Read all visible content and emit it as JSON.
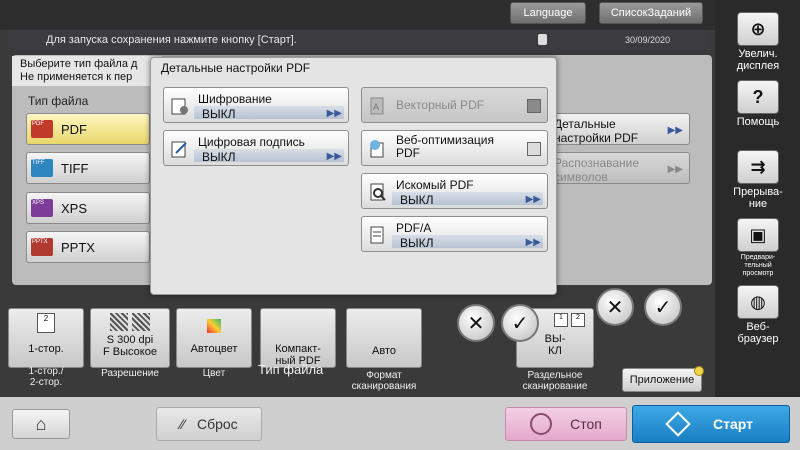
{
  "header": {
    "language_label": "Language",
    "job_list_label": "СписокЗаданий",
    "message": "Для запуска сохранения нажмите кнопку [Старт].",
    "date": "30/09/2020",
    "prompt_line1": "Выберите тип файла д",
    "prompt_line2": "Не применяется к пер"
  },
  "file_type_panel": {
    "label": "Тип файла",
    "items": [
      {
        "label": "PDF",
        "icon": "pdf-file-icon",
        "icon_text": "PDF",
        "color": "#c0392b",
        "selected": true
      },
      {
        "label": "TIFF",
        "icon": "tiff-file-icon",
        "icon_text": "TIFF",
        "color": "#2e86c1",
        "selected": false
      },
      {
        "label": "XPS",
        "icon": "xps-file-icon",
        "icon_text": "XPS",
        "color": "#7d3c98",
        "selected": false
      },
      {
        "label": "PPTX",
        "icon": "pptx-file-icon",
        "icon_text": "PPTX",
        "color": "#b03a2e",
        "selected": false
      }
    ]
  },
  "right_options": {
    "detail_pdf_line1": "Детальные",
    "detail_pdf_line2": "настройки PDF",
    "ocr_line1": "Распознавание",
    "ocr_line2": "символов"
  },
  "dialog": {
    "title": "Детальные настройки PDF",
    "encryption": {
      "title": "Шифрование",
      "value": "ВЫКЛ"
    },
    "signature": {
      "title": "Цифровая подпись",
      "value": "ВЫКЛ"
    },
    "vector_pdf": {
      "title": "Векторный PDF"
    },
    "web_opt": {
      "title_line1": "Веб-оптимизация",
      "title_line2": "PDF"
    },
    "searchable": {
      "title": "Искомый PDF",
      "value": "ВЫКЛ"
    },
    "pdfa": {
      "title": "PDF/A",
      "value": "ВЫКЛ"
    }
  },
  "bottom_tiles": {
    "simplex": {
      "value": "1-стор.",
      "label_line1": "1-стор./",
      "label_line2": "2-стор."
    },
    "resolution": {
      "value_line1": "S 300 dpi",
      "value_line2": "F Высокое",
      "label": "Разрешение"
    },
    "color": {
      "value": "Автоцвет",
      "label": "Цвет"
    },
    "file_type": {
      "value_line1": "Компакт-",
      "value_line2": "ный PDF",
      "label": "Тип файла"
    },
    "format": {
      "value": "Авто",
      "label_line1": "Формат",
      "label_line2": "сканирования"
    },
    "separate": {
      "value_line1": "ВЫ-",
      "value_line2": "КЛ",
      "label_line1": "Раздельное",
      "label_line2": "сканирование"
    },
    "app_label": "Приложение"
  },
  "sidebar": {
    "zoom": {
      "line1": "Увелич.",
      "line2": "дисплея"
    },
    "help": "Помощь",
    "interrupt": {
      "line1": "Прерыва-",
      "line2": "ние"
    },
    "preview": {
      "line1": "Предвари-",
      "line2": "тельный",
      "line3": "просмотр"
    },
    "browser": {
      "line1": "Веб-",
      "line2": "браузер"
    }
  },
  "bottom_bar": {
    "reset_label": "Сброс",
    "stop_label": "Стоп",
    "start_label": "Старт"
  }
}
